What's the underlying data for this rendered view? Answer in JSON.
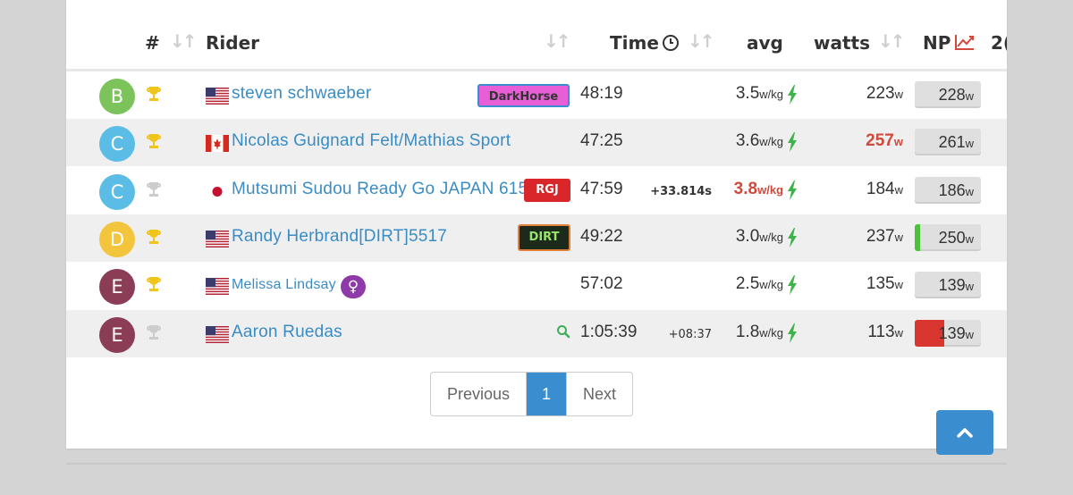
{
  "header": {
    "hash": "#",
    "rider": "Rider",
    "time": "Time",
    "avg": "avg",
    "watts": "watts",
    "np": "NP",
    "next_col": "2("
  },
  "colors": {
    "link": "#3a8cc4",
    "accent": "#3a8ed0",
    "hot": "#d0493b",
    "bolt": "#3cb44b",
    "trophy_gold": "#f0c419",
    "trophy_silver": "#cccccc"
  },
  "rows": [
    {
      "cat": "B",
      "cat_color": "#7dc35b",
      "trophy": "gold",
      "flag": "us",
      "name": "steven schwaeber",
      "team": "DarkHorse",
      "time": "48:19",
      "gap": "",
      "avg": "3.5",
      "unit": "w/kg",
      "watts": "223",
      "watts_unit": "w",
      "np": "228",
      "np_unit": "w",
      "np_fill": 0
    },
    {
      "cat": "C",
      "cat_color": "#5bbde6",
      "trophy": "gold",
      "flag": "ca",
      "name": "Nicolas Guignard Felt/Mathias Sport",
      "team": "",
      "time": "47:25",
      "gap": "",
      "avg": "3.6",
      "unit": "w/kg",
      "watts": "257",
      "watts_unit": "w",
      "np": "261",
      "np_unit": "w",
      "np_fill": 0
    },
    {
      "cat": "C",
      "cat_color": "#5bbde6",
      "trophy": "silver",
      "flag": "jp",
      "name": "Mutsumi Sudou Ready Go JAPAN 615",
      "team": "RGJ",
      "time": "47:59",
      "gap": "+33.814s",
      "avg": "3.8",
      "unit": "w/kg",
      "watts": "184",
      "watts_unit": "w",
      "np": "186",
      "np_unit": "w",
      "np_fill": 0
    },
    {
      "cat": "D",
      "cat_color": "#f2c53d",
      "trophy": "gold",
      "flag": "us",
      "name": "Randy Herbrand[DIRT]5517",
      "team": "DIRT",
      "time": "49:22",
      "gap": "",
      "avg": "3.0",
      "unit": "w/kg",
      "watts": "237",
      "watts_unit": "w",
      "np": "250",
      "np_unit": "w",
      "np_fill": 0.08
    },
    {
      "cat": "E",
      "cat_color": "#8c3d56",
      "trophy": "gold",
      "flag": "us",
      "name": "Melissa Lindsay",
      "team": "",
      "time": "57:02",
      "gap": "",
      "avg": "2.5",
      "unit": "w/kg",
      "watts": "135",
      "watts_unit": "w",
      "np": "139",
      "np_unit": "w",
      "np_fill": 0
    },
    {
      "cat": "E",
      "cat_color": "#8c3d56",
      "trophy": "silver",
      "flag": "us",
      "name": "Aaron Ruedas",
      "team": "",
      "time": "1:05:39",
      "gap": "+08:37",
      "avg": "1.8",
      "unit": "w/kg",
      "watts": "113",
      "watts_unit": "w",
      "np": "139",
      "np_unit": "w",
      "np_fill": 0.45
    }
  ],
  "pagination": {
    "previous": "Previous",
    "current": "1",
    "next": "Next"
  },
  "female_symbol": "♀"
}
